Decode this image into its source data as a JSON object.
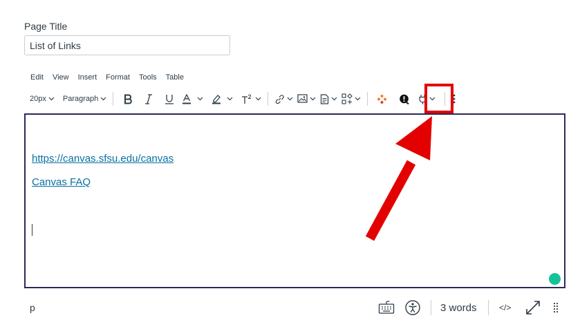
{
  "page": {
    "title_label": "Page Title",
    "title_value": "List of Links"
  },
  "menubar": [
    "Edit",
    "View",
    "Insert",
    "Format",
    "Tools",
    "Table"
  ],
  "toolbar": {
    "font_size": "20px",
    "block_format": "Paragraph",
    "icons": [
      "bold-icon",
      "italic-icon",
      "underline-icon",
      "text-color-icon",
      "highlight-color-icon",
      "superscript-icon",
      "link-icon",
      "image-icon",
      "document-icon",
      "embed-icon",
      "apps-icon",
      "accessibility-checker-icon",
      "plug-icon",
      "more-options-icon"
    ]
  },
  "editor": {
    "links": [
      "https://canvas.sfsu.edu/canvas",
      "Canvas FAQ"
    ]
  },
  "statusbar": {
    "element_path": "p",
    "word_count": "3 words",
    "html_toggle": "</>"
  },
  "colors": {
    "link": "#0770a3",
    "editor_border": "#2a2b5a",
    "annotation": "#e30000",
    "grammarly": "#15c39a"
  }
}
